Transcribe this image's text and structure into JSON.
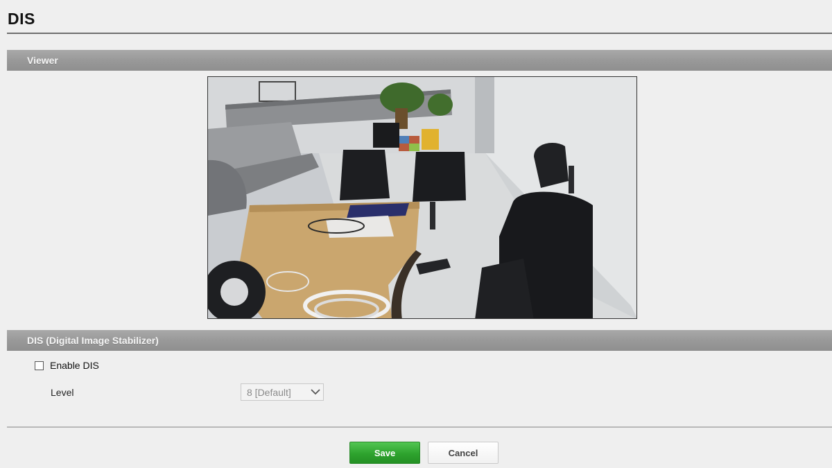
{
  "page": {
    "title": "DIS"
  },
  "viewer": {
    "section_title": "Viewer",
    "image_description": "camera-live-view"
  },
  "dis": {
    "section_title": "DIS (Digital Image Stabilizer)",
    "enable_label": "Enable DIS",
    "enabled": false,
    "level_label": "Level",
    "level_value": "8 [Default]"
  },
  "actions": {
    "save_label": "Save",
    "cancel_label": "Cancel"
  },
  "colors": {
    "section_bar": "#999999",
    "save_button": "#2ea32e",
    "background": "#efefef"
  },
  "icons": {
    "level_dropdown": "chevron-down-icon"
  }
}
